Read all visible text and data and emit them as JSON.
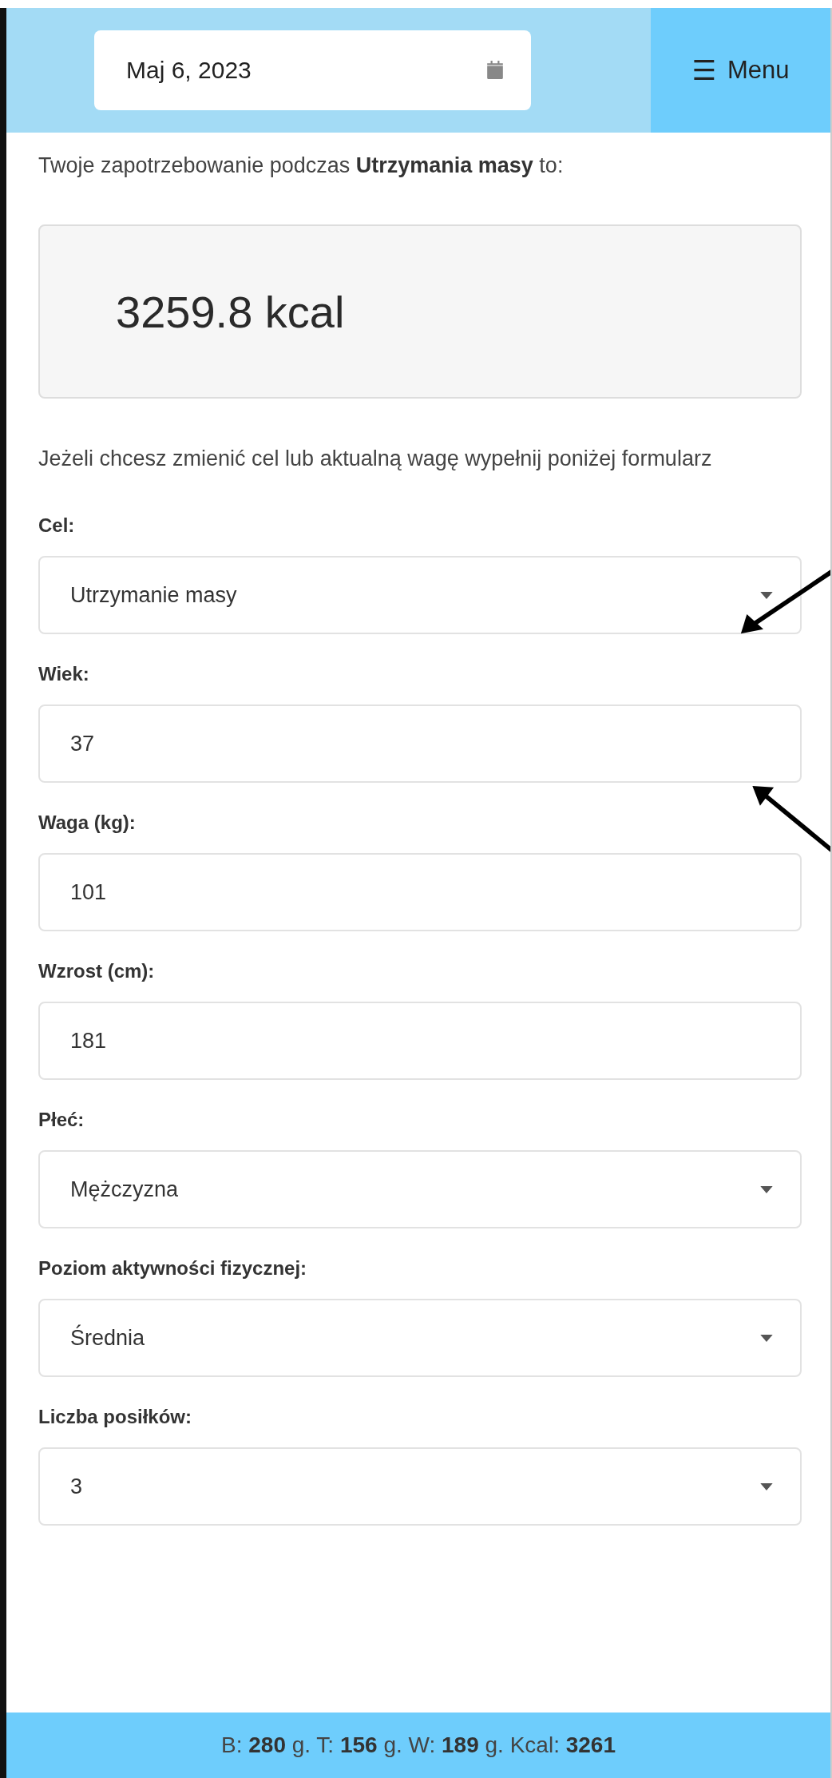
{
  "header": {
    "date": "Maj 6, 2023",
    "menu_icon": "☰",
    "menu_label": "Menu"
  },
  "intro": "Twoje zapotrzebowanie podczas **Utrzymania masy** to:",
  "result": "3259.8 kcal",
  "hint": "Jeżeli chcesz zmienić cel lub aktualną wagę wypełnij poniżej formularz",
  "fields": [
    {
      "label": "Cel:",
      "kind": "select",
      "value": "Utrzymanie masy"
    },
    {
      "label": "Wiek:",
      "kind": "input",
      "value": "37"
    },
    {
      "label": "Waga (kg):",
      "kind": "input",
      "value": "101"
    },
    {
      "label": "Wzrost (cm):",
      "kind": "input",
      "value": "181"
    },
    {
      "label": "Płeć:",
      "kind": "select",
      "value": "Mężczyzna"
    },
    {
      "label": "Poziom aktywności fizycznej:",
      "kind": "select",
      "value": "Średnia"
    },
    {
      "label": "Liczba posiłków:",
      "kind": "select",
      "value": "3"
    }
  ],
  "summary": "B: **280** g. T: **156** g. W: **189** g. Kcal: **3261**"
}
